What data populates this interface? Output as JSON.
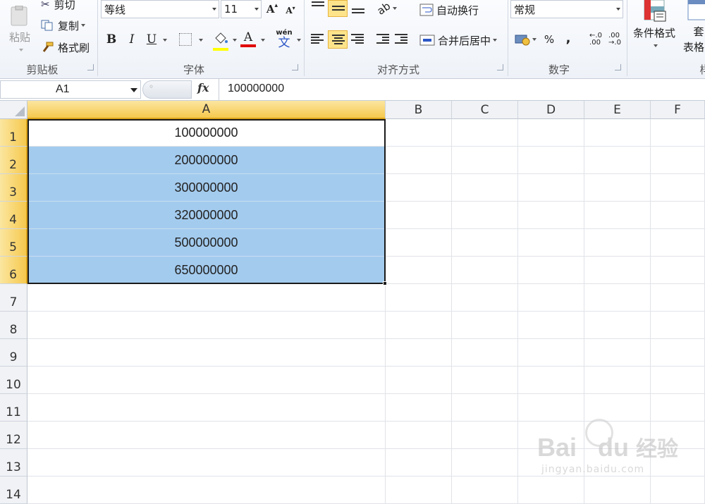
{
  "ribbon": {
    "clipboard": {
      "paste_label": "粘贴",
      "cut_label": "剪切",
      "copy_label": "复制",
      "format_painter_label": "格式刷",
      "group_label": "剪贴板"
    },
    "font": {
      "font_name": "等线",
      "font_size": "11",
      "bold_label": "B",
      "italic_label": "I",
      "underline_label": "U",
      "font_color_label": "A",
      "phonetic_label": "wén",
      "group_label": "字体"
    },
    "alignment": {
      "wrap_text_label": "自动换行",
      "merge_center_label": "合并后居中",
      "group_label": "对齐方式"
    },
    "number": {
      "format_value": "常规",
      "percent_label": "%",
      "comma_label": ",",
      "group_label": "数字"
    },
    "styles": {
      "conditional_format_label": "条件格式",
      "table_format_label_top": "套",
      "table_format_label_bottom": "表格",
      "group_label_partial": "样"
    }
  },
  "formula_bar": {
    "name_box": "A1",
    "fx_label": "fx",
    "content": "100000000"
  },
  "grid": {
    "columns": [
      "A",
      "B",
      "C",
      "D",
      "E",
      "F"
    ],
    "rows": [
      "1",
      "2",
      "3",
      "4",
      "5",
      "6",
      "7",
      "8",
      "9",
      "10",
      "11",
      "12",
      "13",
      "14"
    ],
    "column_a_values": [
      "100000000",
      "200000000",
      "300000000",
      "320000000",
      "500000000",
      "650000000"
    ],
    "selected_range": "A1:A6",
    "highlight_color": "#a3cbee",
    "selection_header_color": "#f6c94e"
  },
  "watermark": {
    "brand": "Bai",
    "brand_suffix": "du",
    "brand_cn": "经验",
    "url": "jingyan.baidu.com"
  }
}
